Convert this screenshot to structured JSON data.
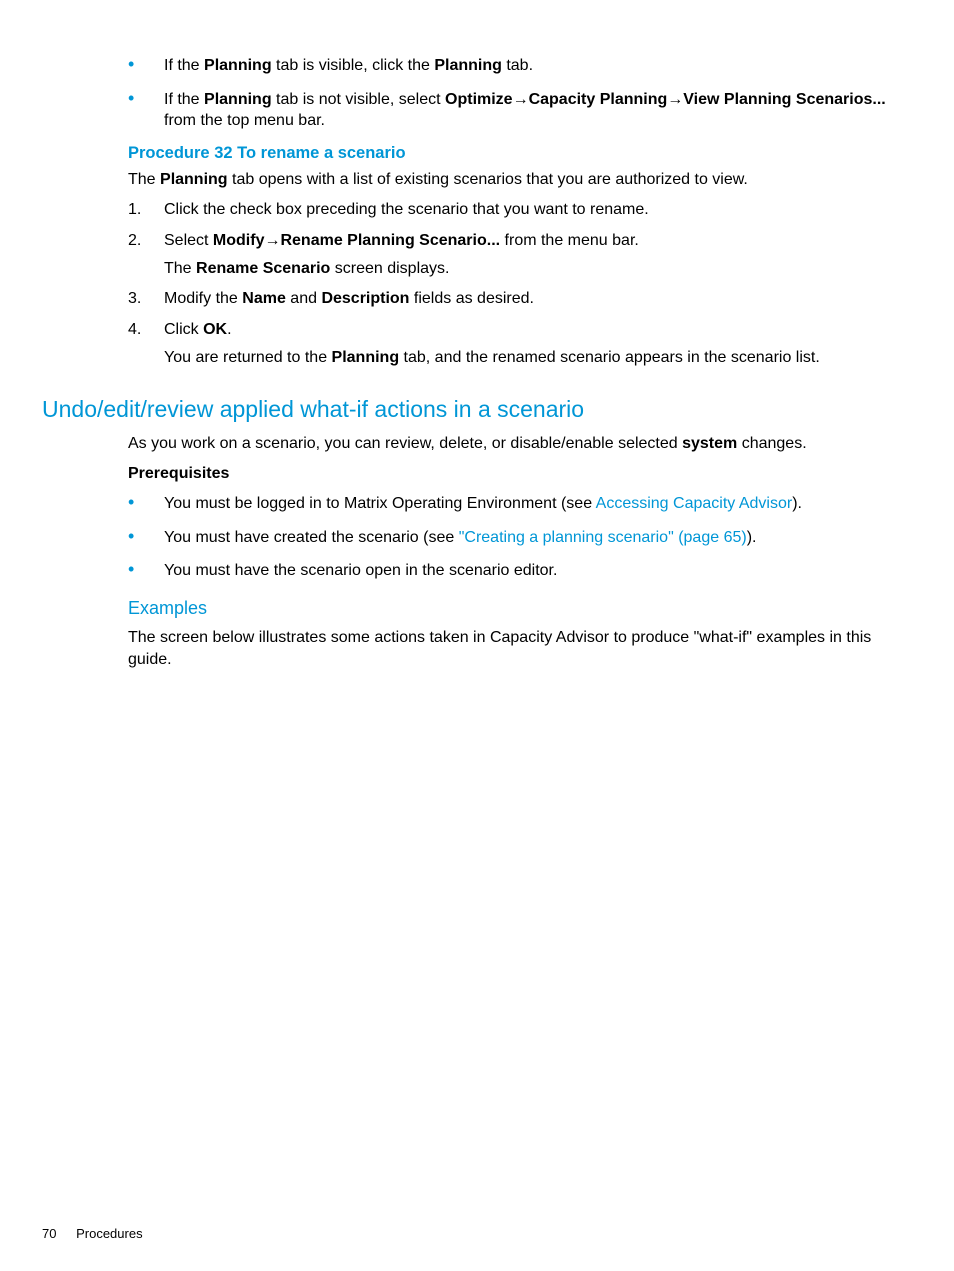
{
  "topBullets": [
    {
      "parts": [
        {
          "t": "If the "
        },
        {
          "t": "Planning",
          "b": true
        },
        {
          "t": " tab is visible, click the "
        },
        {
          "t": "Planning",
          "b": true
        },
        {
          "t": " tab."
        }
      ]
    },
    {
      "parts": [
        {
          "t": "If the "
        },
        {
          "t": "Planning",
          "b": true
        },
        {
          "t": " tab is not visible, select "
        },
        {
          "t": "Optimize",
          "b": true
        },
        {
          "t": "→",
          "b": true,
          "arrow": true
        },
        {
          "t": "Capacity Planning",
          "b": true
        },
        {
          "t": "→",
          "b": true,
          "arrow": true
        },
        {
          "t": "View Planning Scenarios...",
          "b": true
        },
        {
          "t": " from the top menu bar."
        }
      ]
    }
  ],
  "procTitle": "Procedure 32 To rename a scenario",
  "procIntro": {
    "parts": [
      {
        "t": "The "
      },
      {
        "t": "Planning",
        "b": true
      },
      {
        "t": " tab opens with a list of existing scenarios that you are authorized to view."
      }
    ]
  },
  "steps": [
    {
      "lines": [
        {
          "parts": [
            {
              "t": "Click the check box preceding the scenario that you want to rename."
            }
          ]
        }
      ]
    },
    {
      "lines": [
        {
          "parts": [
            {
              "t": "Select "
            },
            {
              "t": "Modify",
              "b": true
            },
            {
              "t": "→",
              "b": true,
              "arrow": true
            },
            {
              "t": "Rename Planning Scenario...",
              "b": true
            },
            {
              "t": " from the menu bar."
            }
          ]
        },
        {
          "parts": [
            {
              "t": "The "
            },
            {
              "t": "Rename Scenario",
              "b": true
            },
            {
              "t": " screen displays."
            }
          ]
        }
      ]
    },
    {
      "lines": [
        {
          "parts": [
            {
              "t": "Modify the "
            },
            {
              "t": "Name",
              "b": true
            },
            {
              "t": " and "
            },
            {
              "t": "Description",
              "b": true
            },
            {
              "t": " fields as desired."
            }
          ]
        }
      ]
    },
    {
      "lines": [
        {
          "parts": [
            {
              "t": "Click "
            },
            {
              "t": "OK",
              "b": true
            },
            {
              "t": "."
            }
          ]
        },
        {
          "parts": [
            {
              "t": "You are returned to the "
            },
            {
              "t": "Planning",
              "b": true
            },
            {
              "t": " tab, and the renamed scenario appears in the scenario list."
            }
          ]
        }
      ]
    }
  ],
  "sectionTitle": "Undo/edit/review applied what-if actions in a scenario",
  "sectionIntro": {
    "parts": [
      {
        "t": "As you work on a scenario, you can review, delete, or disable/enable selected "
      },
      {
        "t": "system",
        "b": true
      },
      {
        "t": " changes."
      }
    ]
  },
  "prereqLabel": "Prerequisites",
  "prereqs": [
    {
      "parts": [
        {
          "t": "You must be logged in to Matrix Operating Environment (see "
        },
        {
          "t": "Accessing Capacity Advisor",
          "link": true
        },
        {
          "t": ")."
        }
      ]
    },
    {
      "parts": [
        {
          "t": "You must have created the scenario (see "
        },
        {
          "t": "\"Creating a planning scenario\" (page 65)",
          "link": true
        },
        {
          "t": ")."
        }
      ]
    },
    {
      "parts": [
        {
          "t": "You must have the scenario open in the scenario editor."
        }
      ]
    }
  ],
  "examplesTitle": "Examples",
  "examplesText": "The screen below illustrates some actions taken in Capacity Advisor to produce \"what-if\" examples in this guide.",
  "footer": {
    "pageNum": "70",
    "section": "Procedures"
  }
}
